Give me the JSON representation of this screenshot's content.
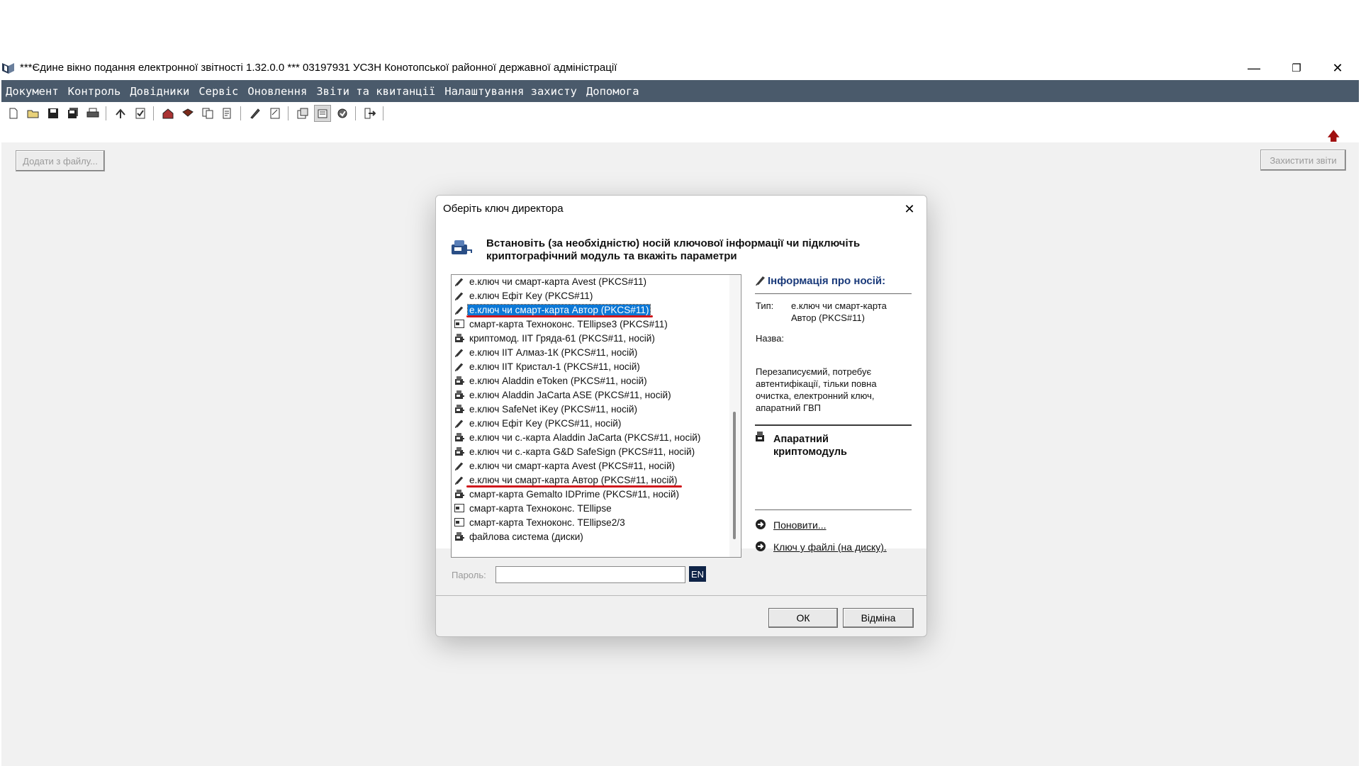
{
  "window": {
    "title": "***Єдине вікно подання електронної звітності 1.32.0.0 *** 03197931 УСЗН Конотопської районної державної адміністрації",
    "minimize": "—",
    "restore": "❐",
    "close": "✕"
  },
  "menu": [
    "Документ",
    "Контроль",
    "Довідники",
    "Сервіс",
    "Оновлення",
    "Звіти та квитанції",
    "Налаштування захисту",
    "Допомога"
  ],
  "toolbar_icons": [
    "new-doc-icon",
    "open-folder-icon",
    "save-icon",
    "save-all-icon",
    "print-icon",
    "send-icon",
    "check-icon",
    "house-icon",
    "book-icon",
    "copy-icon",
    "receipt-icon",
    "sign-icon",
    "verify-icon",
    "settings-icon",
    "archive-icon",
    "protect-icon",
    "exit-icon"
  ],
  "workarea": {
    "add_from_file_label": "Додати з файлу...",
    "protect_reports_label": "Захистити звіти"
  },
  "dialog": {
    "title": "Оберіть ключ директора",
    "close": "✕",
    "header_text": "Встановіть (за необхідністю) носій ключової інформації чи підключіть криптографічний модуль та вкажіть параметри",
    "media_list": [
      {
        "label": "е.ключ чи смарт-карта Avest (PKCS#11)",
        "icon": "pen-icon"
      },
      {
        "label": "е.ключ Ефіт Key (PKCS#11)",
        "icon": "pen-icon"
      },
      {
        "label": "е.ключ чи смарт-карта Автор (PKCS#11)",
        "icon": "pen-icon",
        "selected": true,
        "underlined": true
      },
      {
        "label": "смарт-карта Техноконс. TEllipse3 (PKCS#11)",
        "icon": "card-icon"
      },
      {
        "label": "криптомод. ІІТ Гряда-61 (PKCS#11, носій)",
        "icon": "device-icon"
      },
      {
        "label": "е.ключ ІІТ Алмаз-1К (PKCS#11, носій)",
        "icon": "pen-icon"
      },
      {
        "label": "е.ключ ІІТ Кристал-1 (PKCS#11, носій)",
        "icon": "pen-icon"
      },
      {
        "label": "е.ключ Aladdin eToken (PKCS#11, носій)",
        "icon": "device-icon"
      },
      {
        "label": "е.ключ Aladdin JaCarta ASE (PKCS#11, носій)",
        "icon": "device-icon"
      },
      {
        "label": "е.ключ SafeNet iKey (PKCS#11, носій)",
        "icon": "device-icon"
      },
      {
        "label": "е.ключ Ефіт Key (PKCS#11, носій)",
        "icon": "pen-icon"
      },
      {
        "label": "е.ключ чи с.-карта Aladdin JaCarta (PKCS#11, носій)",
        "icon": "device-icon"
      },
      {
        "label": "е.ключ чи с.-карта G&D SafeSign (PKCS#11, носій)",
        "icon": "device-icon"
      },
      {
        "label": "е.ключ чи смарт-карта Avest (PKCS#11, носій)",
        "icon": "pen-icon"
      },
      {
        "label": "е.ключ чи смарт-карта Автор (PKCS#11, носій)",
        "icon": "pen-icon",
        "underlined": true
      },
      {
        "label": "смарт-карта Gemalto IDPrime (PKCS#11, носій)",
        "icon": "device-icon"
      },
      {
        "label": "смарт-карта Техноконс. TEllipse",
        "icon": "card-icon"
      },
      {
        "label": "смарт-карта Техноконс. TEllipse2/3",
        "icon": "card-icon"
      },
      {
        "label": "файлова система (диски)",
        "icon": "device-icon"
      }
    ],
    "password_label": "Пароль:",
    "password_value": "",
    "lang_indicator": "EN",
    "info": {
      "title": "Інформація про носій:",
      "type_label": "Тип:",
      "type_value": "е.ключ чи смарт-карта Автор (PKCS#11)",
      "name_label": "Назва:",
      "name_value": "",
      "description": "Перезаписуємий, потребує автентифікації, тільки повна очистка, електронний ключ, апаратний ГВП",
      "hardware_label": "Апаратний криптомодуль",
      "refresh_link": "Поновити...",
      "file_key_link": "Ключ у файлі (на диску)."
    },
    "ok_label": "ОК",
    "cancel_label": "Відміна"
  },
  "colors": {
    "menubar": "#4a5a6b",
    "selection": "#0b78d7",
    "underline_mark": "#d0161b",
    "lang_badge": "#0f2447"
  }
}
